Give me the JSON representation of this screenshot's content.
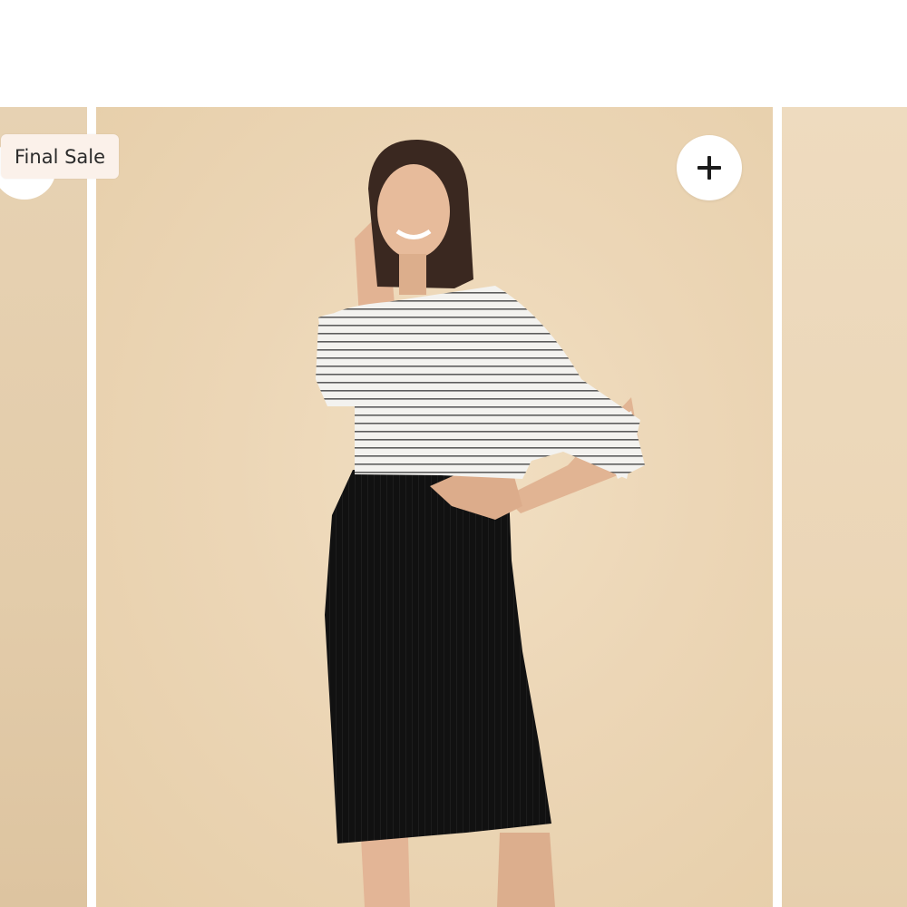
{
  "product_card": {
    "badge": "Final Sale",
    "add_button_icon": "plus-icon"
  },
  "colors": {
    "background": "#ffffff",
    "card_beige": "#ecd6b6",
    "badge_bg": "#fbf1ea",
    "skirt": "#111111"
  }
}
